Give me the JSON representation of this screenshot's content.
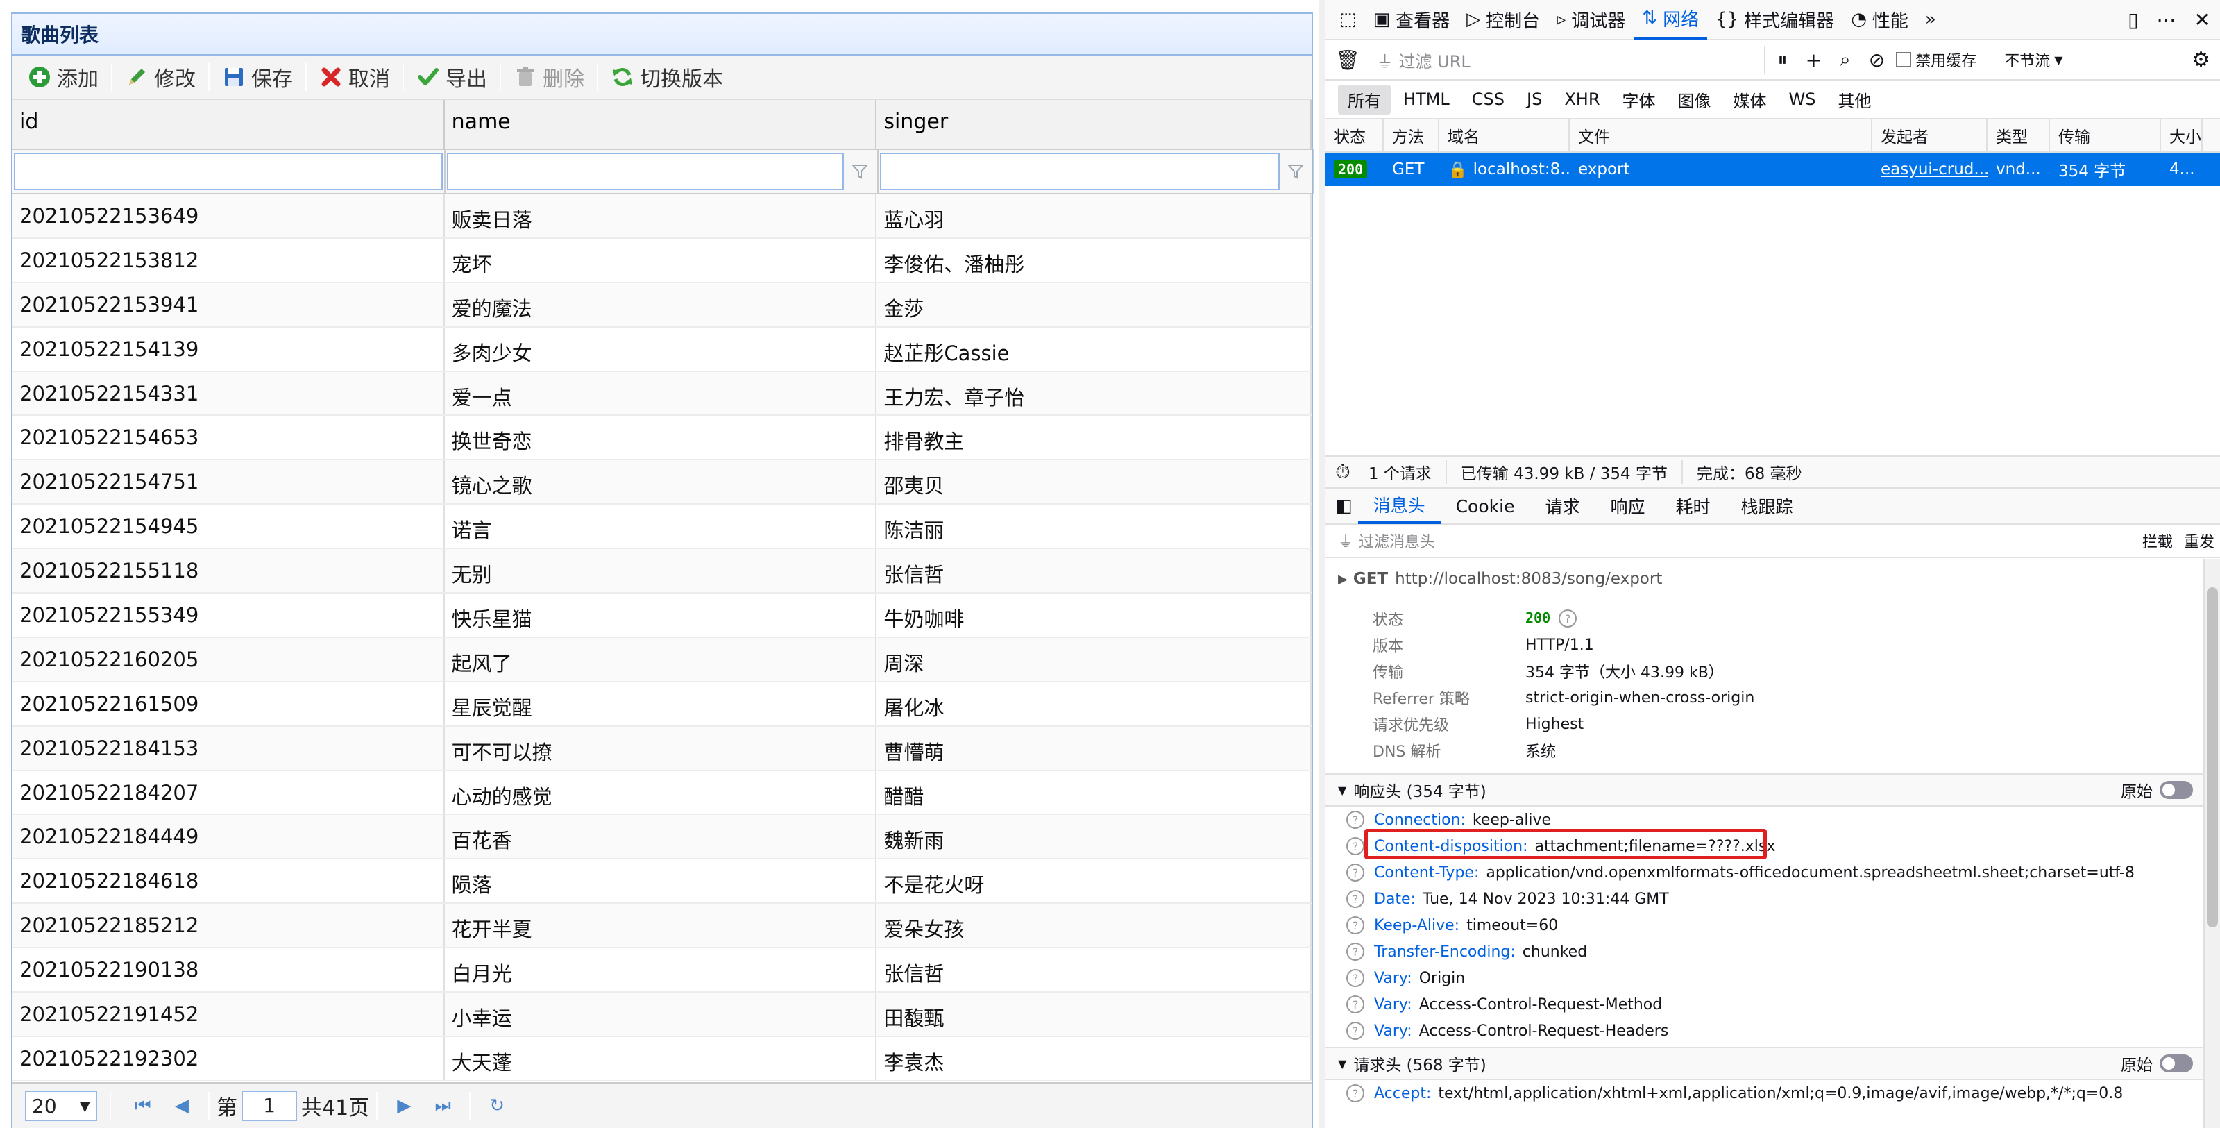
{
  "grid": {
    "title": "歌曲列表",
    "toolbar": [
      {
        "label": "添加",
        "icon": "add-icon"
      },
      {
        "label": "修改",
        "icon": "edit-icon"
      },
      {
        "label": "保存",
        "icon": "save-icon"
      },
      {
        "label": "取消",
        "icon": "cancel-icon"
      },
      {
        "label": "导出",
        "icon": "export-icon"
      },
      {
        "label": "删除",
        "icon": "delete-icon",
        "disabled": true
      },
      {
        "label": "切换版本",
        "icon": "refresh-icon"
      }
    ],
    "columns": [
      "id",
      "name",
      "singer"
    ],
    "rows": [
      [
        "20210522153649",
        "贩卖日落",
        "蓝心羽"
      ],
      [
        "20210522153812",
        "宠坏",
        "李俊佑、潘柚彤"
      ],
      [
        "20210522153941",
        "爱的魔法",
        "金莎"
      ],
      [
        "20210522154139",
        "多肉少女",
        "赵芷彤Cassie"
      ],
      [
        "20210522154331",
        "爱一点",
        "王力宏、章子怡"
      ],
      [
        "20210522154653",
        "换世奇恋",
        "排骨教主"
      ],
      [
        "20210522154751",
        "镜心之歌",
        "邵夷贝"
      ],
      [
        "20210522154945",
        "诺言",
        "陈洁丽"
      ],
      [
        "20210522155118",
        "无别",
        "张信哲"
      ],
      [
        "20210522155349",
        "快乐星猫",
        "牛奶咖啡"
      ],
      [
        "20210522160205",
        "起风了",
        "周深"
      ],
      [
        "20210522161509",
        "星辰觉醒",
        "屠化冰"
      ],
      [
        "20210522184153",
        "可不可以撩",
        "曹懵萌"
      ],
      [
        "20210522184207",
        "心动的感觉",
        "醋醋"
      ],
      [
        "20210522184449",
        "百花香",
        "魏新雨"
      ],
      [
        "20210522184618",
        "陨落",
        "不是花火呀"
      ],
      [
        "20210522185212",
        "花开半夏",
        "爱朵女孩"
      ],
      [
        "20210522190138",
        "白月光",
        "张信哲"
      ],
      [
        "20210522191452",
        "小幸运",
        "田馥甄"
      ],
      [
        "20210522192302",
        "大天蓬",
        "李袁杰"
      ]
    ],
    "pager": {
      "page_size": "20",
      "page_label_prefix": "第",
      "page_value": "1",
      "page_total": "共41页"
    }
  },
  "devtools": {
    "tabs": [
      {
        "label": "查看器",
        "icon": "inspector-icon"
      },
      {
        "label": "控制台",
        "icon": "console-icon"
      },
      {
        "label": "调试器",
        "icon": "debugger-icon"
      },
      {
        "label": "网络",
        "icon": "network-icon",
        "active": true
      },
      {
        "label": "样式编辑器",
        "icon": "style-editor-icon"
      },
      {
        "label": "性能",
        "icon": "performance-icon"
      }
    ],
    "filter_url_placeholder": "过滤 URL",
    "disable_cache_label": "禁用缓存",
    "throttle_label": "不节流",
    "type_filters": [
      "所有",
      "HTML",
      "CSS",
      "JS",
      "XHR",
      "字体",
      "图像",
      "媒体",
      "WS",
      "其他"
    ],
    "request_columns": [
      "状态",
      "方法",
      "域名",
      "文件",
      "发起者",
      "类型",
      "传输",
      "大小"
    ],
    "request": {
      "status": "200",
      "method": "GET",
      "domain": "localhost:8...",
      "file": "export",
      "initiator": "easyui-crud...",
      "type": "vnd...",
      "transferred": "354 字节",
      "size": "4..."
    },
    "summary": {
      "requests": "1 个请求",
      "transferred": "已传输 43.99 kB / 354 字节",
      "finish": "完成：68 毫秒"
    },
    "detail_tabs": [
      "消息头",
      "Cookie",
      "请求",
      "响应",
      "耗时",
      "栈跟踪"
    ],
    "filter_headers_placeholder": "过滤消息头",
    "filter_headers_actions": [
      "拦截",
      "重发"
    ],
    "get_method": "GET",
    "get_url": "http://localhost:8083/song/export",
    "general": [
      {
        "k": "状态",
        "v": "200"
      },
      {
        "k": "版本",
        "v": "HTTP/1.1"
      },
      {
        "k": "传输",
        "v": "354 字节（大小 43.99 kB）"
      },
      {
        "k": "Referrer 策略",
        "v": "strict-origin-when-cross-origin"
      },
      {
        "k": "请求优先级",
        "v": "Highest"
      },
      {
        "k": "DNS 解析",
        "v": "系统"
      }
    ],
    "response_headers_title": "响应头 (354 字节)",
    "raw_label": "原始",
    "response_headers": [
      {
        "name": "Connection:",
        "value": "keep-alive"
      },
      {
        "name": "Content-disposition:",
        "value": "attachment;filename=????.xlsx"
      },
      {
        "name": "Content-Type:",
        "value": "application/vnd.openxmlformats-officedocument.spreadsheetml.sheet;charset=utf-8"
      },
      {
        "name": "Date:",
        "value": "Tue, 14 Nov 2023 10:31:44 GMT"
      },
      {
        "name": "Keep-Alive:",
        "value": "timeout=60"
      },
      {
        "name": "Transfer-Encoding:",
        "value": "chunked"
      },
      {
        "name": "Vary:",
        "value": "Origin"
      },
      {
        "name": "Vary:",
        "value": "Access-Control-Request-Method"
      },
      {
        "name": "Vary:",
        "value": "Access-Control-Request-Headers"
      }
    ],
    "request_headers_title": "请求头 (568 字节)",
    "request_headers": [
      {
        "name": "Accept:",
        "value": "text/html,application/xhtml+xml,application/xml;q=0.9,image/avif,image/webp,*/*;q=0.8"
      }
    ]
  }
}
